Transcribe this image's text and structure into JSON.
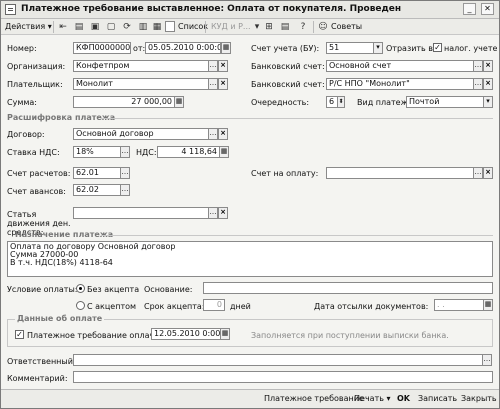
{
  "title": "Платежное требование выставленное: Оплата от покупателя. Проведен",
  "toolbar": {
    "actions": "Действия",
    "list": "Список",
    "kud": "КУД и Р...",
    "advice": "Советы"
  },
  "header": {
    "number_label": "Номер:",
    "number": "КФП00000002",
    "from_label": "от:",
    "date": "05.05.2010  0:00:00",
    "account_label": "Счет учета (БУ):",
    "account": "51",
    "reflect_label": "Отразить в:",
    "tax_label": "налог. учете",
    "org_label": "Организация:",
    "org": "Конфетпром",
    "bank1_label": "Банковский счет:",
    "bank1": "Основной счет",
    "payer_label": "Плательщик:",
    "payer": "Монолит",
    "bank2_label": "Банковский счет:",
    "bank2": "Р/С НПО \"Монолит\"",
    "sum_label": "Сумма:",
    "sum": "27 000,00",
    "queue_label": "Очередность:",
    "queue": "6",
    "paytype_label": "Вид платежа:",
    "paytype": "Почтой"
  },
  "details": {
    "section": "Расшифровка платежа",
    "contract_label": "Договор:",
    "contract": "Основной договор",
    "vat_rate_label": "Ставка НДС:",
    "vat_rate": "18%",
    "vat_label": "НДС:",
    "vat": "4 118,64",
    "settle_label": "Счет расчетов:",
    "settle": "62.01",
    "invoice_label": "Счет на оплату:",
    "advance_label": "Счет авансов:",
    "advance": "62.02",
    "cashflow_label": "Статья движения ден. средств:"
  },
  "purpose": {
    "section": "Назначение платежа",
    "lines": [
      "Оплата по договору Основной договор",
      "Сумма 27000-00",
      "В т.ч. НДС(18%) 4118-64"
    ]
  },
  "condition": {
    "label": "Условие оплаты:",
    "without": "Без акцепта",
    "with": "С акцептом",
    "basis_label": "Основание:",
    "term_label": "Срок акцепта:",
    "term": "0",
    "days": "дней",
    "docdate_label": "Дата отсылки документов:",
    "docdate": ". ."
  },
  "payment": {
    "section": "Данные об оплате",
    "paid_label": "Платежное требование оплачено",
    "paid_date": "12.05.2010  0:00:00",
    "hint": "Заполняется при поступлении выписки банка."
  },
  "bottom": {
    "resp_label": "Ответственный:",
    "comment_label": "Комментарий:"
  },
  "status": {
    "req": "Платежное требование",
    "print": "Печать",
    "ok": "OK",
    "save": "Записать",
    "close": "Закрыть"
  }
}
